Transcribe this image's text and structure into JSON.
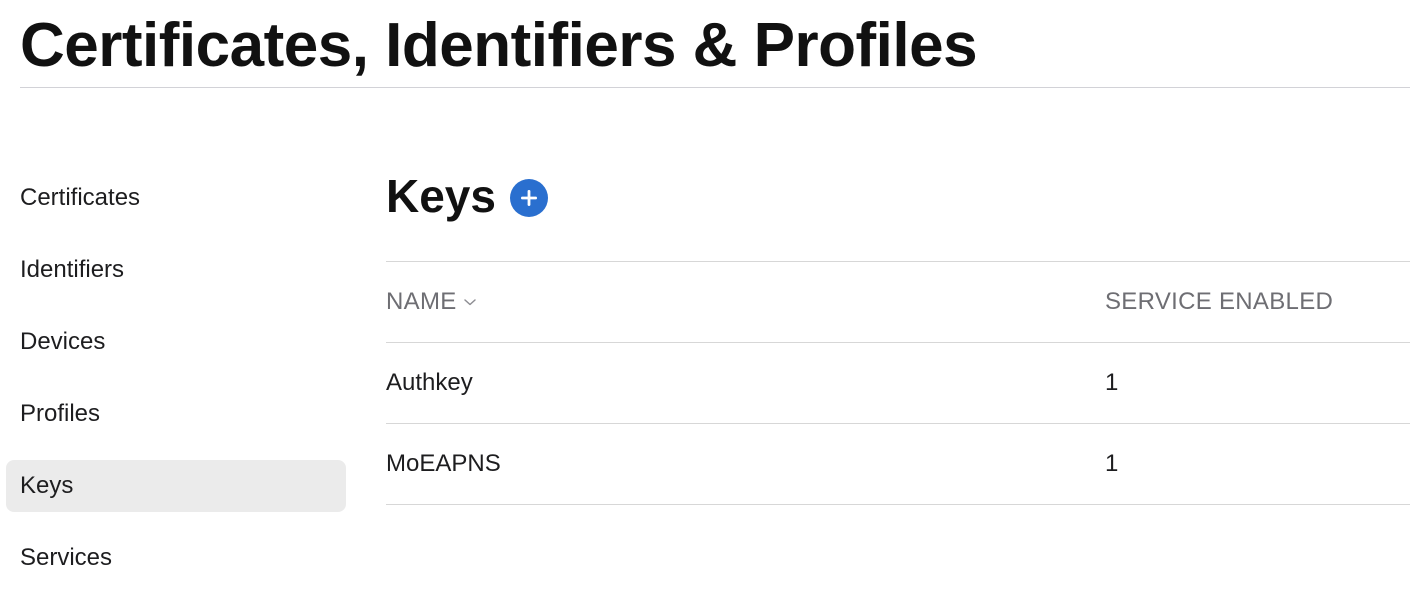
{
  "header": {
    "title": "Certificates, Identifiers & Profiles"
  },
  "sidebar": {
    "items": [
      {
        "label": "Certificates",
        "active": false
      },
      {
        "label": "Identifiers",
        "active": false
      },
      {
        "label": "Devices",
        "active": false
      },
      {
        "label": "Profiles",
        "active": false
      },
      {
        "label": "Keys",
        "active": true
      },
      {
        "label": "Services",
        "active": false
      }
    ]
  },
  "main": {
    "section_title": "Keys",
    "add_icon": "plus-circle-icon",
    "table": {
      "columns": [
        {
          "label": "NAME",
          "sortable": true,
          "sort_icon": "chevron-down-icon"
        },
        {
          "label": "SERVICE ENABLED",
          "sortable": false
        }
      ],
      "rows": [
        {
          "name": "Authkey",
          "service_enabled": "1"
        },
        {
          "name": "MoEAPNS",
          "service_enabled": "1"
        }
      ]
    }
  },
  "colors": {
    "accent": "#2a6fcf",
    "active_item_bg": "#ebebeb",
    "divider": "#d7d7d7",
    "muted_text": "#6e6e73"
  }
}
